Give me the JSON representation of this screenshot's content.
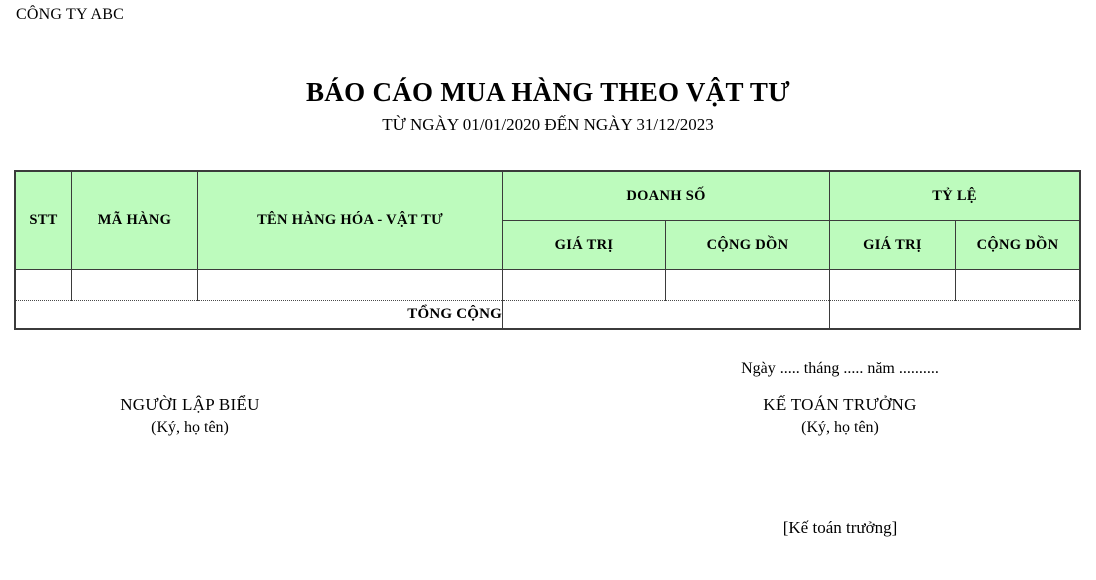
{
  "document": {
    "company": "CÔNG TY ABC",
    "title": "BÁO CÁO MUA HÀNG THEO VẬT TƯ",
    "subtitle": "TỪ NGÀY 01/01/2020 ĐẾN NGÀY 31/12/2023",
    "header_fill_color": "#BDFBBD",
    "border_color": "#3B3B3B"
  },
  "table": {
    "headers": {
      "stt": "STT",
      "ma_hang": "MÃ HÀNG",
      "ten_hang": "TÊN HÀNG HÓA - VẬT TƯ",
      "doanh_so": "DOANH SỐ",
      "ty_le": "TỶ LỆ",
      "doanh_so_gia_tri": "GIÁ TRỊ",
      "doanh_so_cong_don": "CỘNG DỒN",
      "ty_le_gia_tri": "GIÁ TRỊ",
      "ty_le_cong_don": "CỘNG DỒN"
    },
    "rows": [
      {
        "stt": "",
        "ma_hang": "",
        "ten_hang": "",
        "doanh_so_gia_tri": "",
        "doanh_so_cong_don": "",
        "ty_le_gia_tri": "",
        "ty_le_cong_don": ""
      }
    ],
    "total_row": {
      "label": "TỔNG CỘNG",
      "doanh_so": "",
      "ty_le": ""
    }
  },
  "signatures": {
    "date_line": "Ngày ..... tháng ..... năm ..........",
    "left": {
      "role": "NGƯỜI LẬP BIỂU",
      "note": "(Ký, họ tên)"
    },
    "right": {
      "role": "KẾ TOÁN TRƯỞNG",
      "note": "(Ký, họ tên)"
    }
  },
  "footer": {
    "note": "[Kế toán trưởng]"
  }
}
